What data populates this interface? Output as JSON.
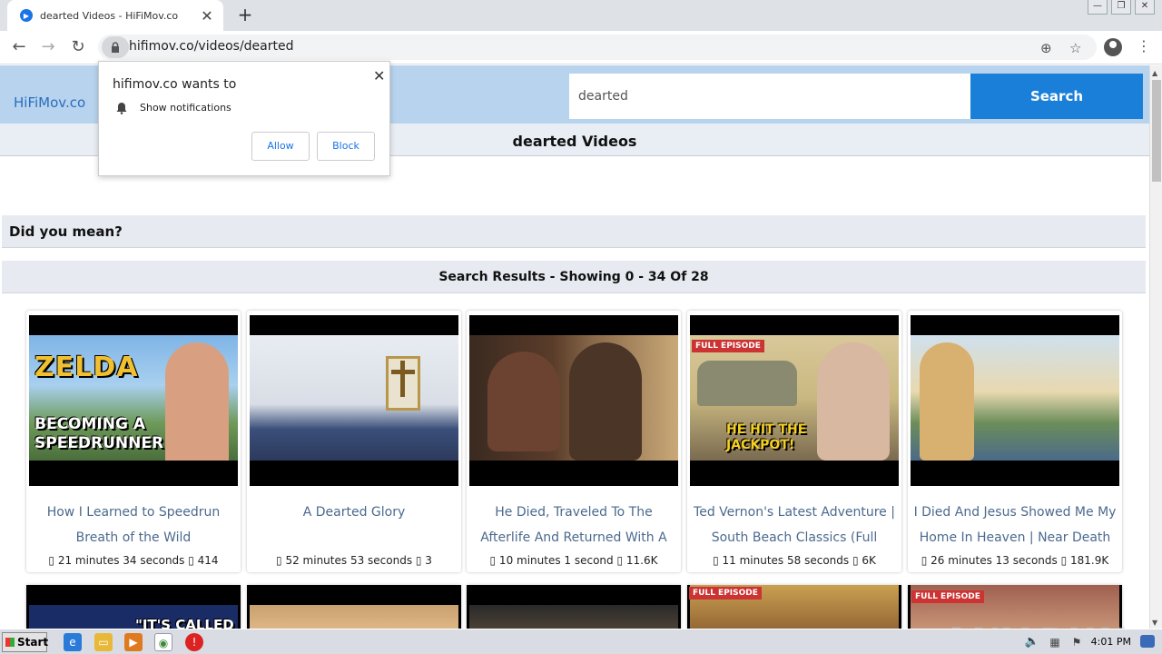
{
  "browser": {
    "tab_title": "dearted Videos - HiFiMov.co",
    "url": "hifimov.co/videos/dearted"
  },
  "site": {
    "brand": "HiFiMov.co",
    "search_value": "dearted",
    "search_button": "Search",
    "page_title": "dearted Videos",
    "did_you_mean": "Did you mean?",
    "results_text": "Search Results - Showing 0 - 34 Of 28"
  },
  "videos": [
    {
      "title": "How I Learned to Speedrun Breath of the Wild",
      "meta": "▯ 21 minutes 34 seconds ▯ 414",
      "overlay": "BECOMING A SPEEDRUNNER",
      "logo": "ZELDA"
    },
    {
      "title": "A Dearted Glory",
      "meta": "▯ 52 minutes 53 seconds ▯ 3"
    },
    {
      "title": "He Died, Traveled To The Afterlife And Returned With A",
      "meta": "▯ 10 minutes 1 second ▯ 11.6K"
    },
    {
      "title": "Ted Vernon's Latest Adventure | South Beach Classics (Full",
      "meta": "▯ 11 minutes 58 seconds ▯ 6K",
      "badge": "FULL EPISODE",
      "overlay": "HE HIT THE JACKPOT!"
    },
    {
      "title": "I Died And Jesus Showed Me My Home In Heaven | Near Death",
      "meta": "▯ 26 minutes 13 seconds ▯ 181.9K"
    }
  ],
  "row2": {
    "overlay1": "\"IT'S CALLED",
    "badge4": "FULL EPISODE",
    "badge5": "FULL EPISODE"
  },
  "notification": {
    "heading": "hifimov.co wants to",
    "text": "Show notifications",
    "allow": "Allow",
    "block": "Block"
  },
  "taskbar": {
    "start": "Start",
    "clock": "4:01 PM"
  },
  "watermark": "ANY.RUN"
}
